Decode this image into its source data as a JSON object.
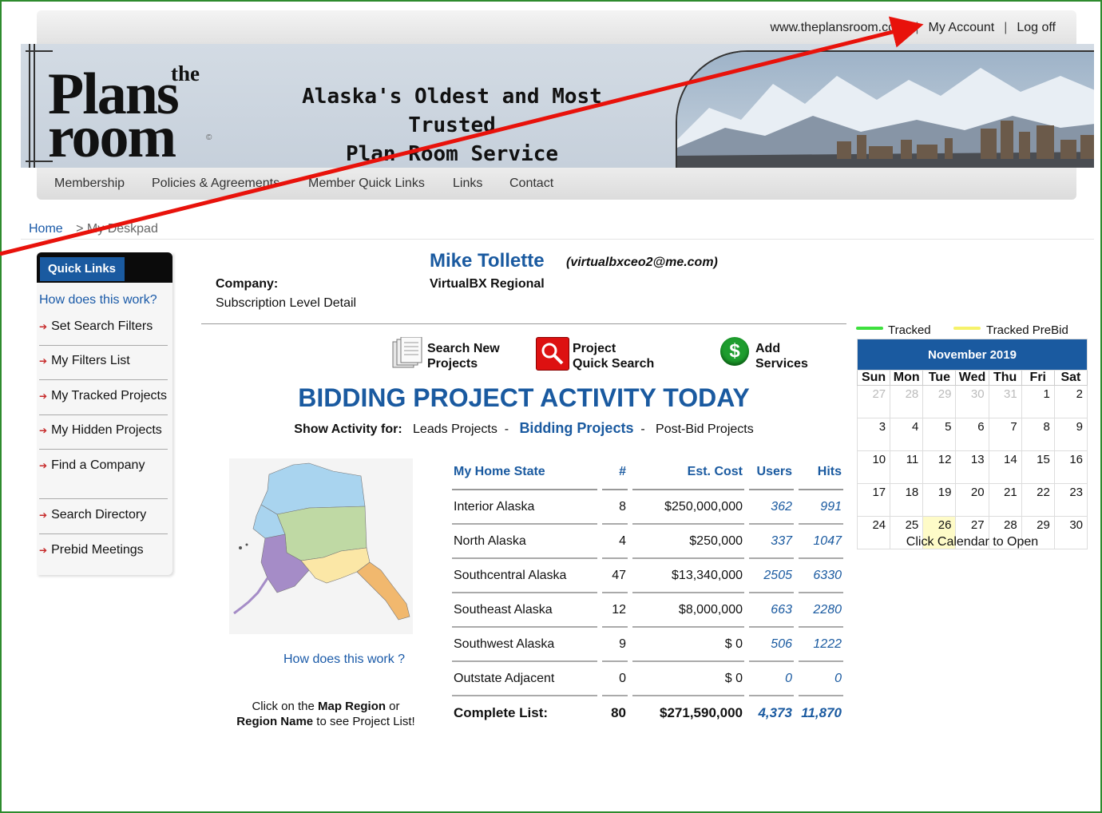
{
  "header": {
    "site_link": "www.theplansroom.com",
    "separator": "|",
    "my_account": "My Account",
    "log_off": "Log off"
  },
  "banner": {
    "logo_the": "the",
    "logo_plans": "Plans",
    "logo_room": "room",
    "logo_copyright": "©",
    "tagline_line1": "Alaska's Oldest and Most Trusted",
    "tagline_line2": "Plan Room Service"
  },
  "nav": {
    "items": [
      "Membership",
      "Policies & Agreements",
      "Member Quick Links",
      "Links",
      "Contact"
    ]
  },
  "breadcrumb": {
    "home": "Home",
    "current": "> My Deskpad"
  },
  "sidebar": {
    "title": "Quick Links",
    "help": "How does this work?",
    "items": [
      "Set Search Filters",
      "My Filters List",
      "My Tracked Projects",
      "My Hidden Projects",
      "Find a Company",
      "Search Directory",
      "Prebid Meetings"
    ]
  },
  "profile": {
    "name": "Mike Tollette",
    "email": "(virtualbxceo2@me.com)",
    "company_label": "Company:",
    "company": "VirtualBX Regional",
    "subscription": "Subscription Level Detail"
  },
  "actions": {
    "search_new_1": "Search New",
    "search_new_2": "Projects",
    "quick_search_1": "Project",
    "quick_search_2": "Quick Search",
    "add_services_1": "Add",
    "add_services_2": "Services"
  },
  "activity": {
    "title": "BIDDING PROJECT ACTIVITY TODAY",
    "show_label": "Show Activity for:",
    "leads": "Leads Projects",
    "dash": "-",
    "bidding": "Bidding Projects",
    "postbid": "Post-Bid Projects"
  },
  "map": {
    "help": "How does this work ?",
    "note_1": "Click on the ",
    "note_b1": "Map Region",
    "note_2": " or",
    "note_b2": "Region Name",
    "note_3": " to see Project List!",
    "region_colors": {
      "north": "#a9d4ef",
      "interior": "#bfd9a4",
      "southwest": "#a58cc7",
      "southcentral": "#fbe7a6",
      "southeast": "#f1b86e"
    }
  },
  "table": {
    "headers": [
      "My Home State",
      "#",
      "Est. Cost",
      "Users",
      "Hits"
    ],
    "rows": [
      [
        "Interior Alaska",
        "8",
        "$250,000,000",
        "362",
        "991"
      ],
      [
        "North Alaska",
        "4",
        "$250,000",
        "337",
        "1047"
      ],
      [
        "Southcentral Alaska",
        "47",
        "$13,340,000",
        "2505",
        "6330"
      ],
      [
        "Southeast Alaska",
        "12",
        "$8,000,000",
        "663",
        "2280"
      ],
      [
        "Southwest Alaska",
        "9",
        "$ 0",
        "506",
        "1222"
      ],
      [
        "Outstate Adjacent",
        "0",
        "$ 0",
        "0",
        "0"
      ],
      [
        "Complete List:",
        "80",
        "$271,590,000",
        "4,373",
        "11,870"
      ]
    ]
  },
  "calendar": {
    "legend_tracked": "Tracked",
    "legend_prebid": "Tracked PreBid",
    "tracked_color": "#3ee03e",
    "prebid_color": "#f6f26a",
    "month": "November 2019",
    "days": [
      "Sun",
      "Mon",
      "Tue",
      "Wed",
      "Thu",
      "Fri",
      "Sat"
    ],
    "weeks": [
      [
        "27",
        "28",
        "29",
        "30",
        "31",
        "1",
        "2"
      ],
      [
        "3",
        "4",
        "5",
        "6",
        "7",
        "8",
        "9"
      ],
      [
        "10",
        "11",
        "12",
        "13",
        "14",
        "15",
        "16"
      ],
      [
        "17",
        "18",
        "19",
        "20",
        "21",
        "22",
        "23"
      ],
      [
        "24",
        "25",
        "26",
        "27",
        "28",
        "29",
        "30"
      ]
    ],
    "other_month": [
      [
        0,
        0
      ],
      [
        0,
        1
      ],
      [
        0,
        2
      ],
      [
        0,
        3
      ],
      [
        0,
        4
      ]
    ],
    "today": [
      4,
      2
    ],
    "note": "Click Calendar to Open"
  }
}
